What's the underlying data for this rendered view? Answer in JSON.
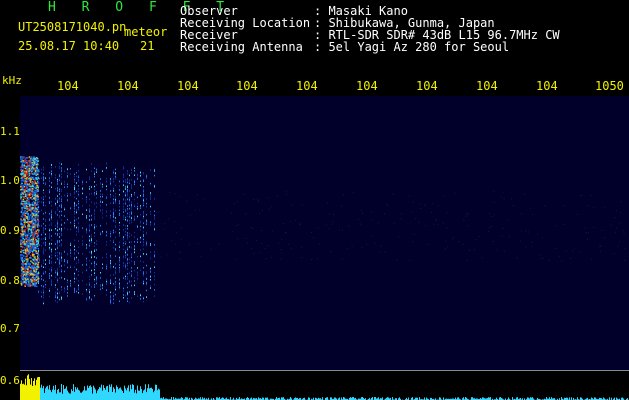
{
  "header": {
    "brand": "H R O F F T",
    "filename": "UT2508171040.pn",
    "tag": "meteor",
    "datetime": "25.08.17 10:40",
    "count": "21"
  },
  "info": [
    {
      "label": "Observer",
      "value": ": Masaki Kano"
    },
    {
      "label": "Receiving Location",
      "value": ": Shibukawa, Gunma, Japan"
    },
    {
      "label": "Receiver",
      "value": ": RTL-SDR SDR# 43dB L15 96.7MHz CW"
    },
    {
      "label": "Receiving Antenna",
      "value": ": 5el Yagi Az 280 for Seoul"
    }
  ],
  "axis": {
    "y_unit": "kHz",
    "y_ticks": [
      "1.1",
      "1.0",
      "0.9",
      "0.8",
      "0.7",
      "0.6"
    ],
    "x_ticks": [
      "104",
      "104",
      "104",
      "104",
      "104",
      "104",
      "104",
      "104",
      "104",
      "1050"
    ]
  },
  "colors": {
    "label_green": "#2ee83a",
    "value_white": "#ffffff",
    "axis_yellow": "#f2f200",
    "plot_background": "#00002a"
  }
}
